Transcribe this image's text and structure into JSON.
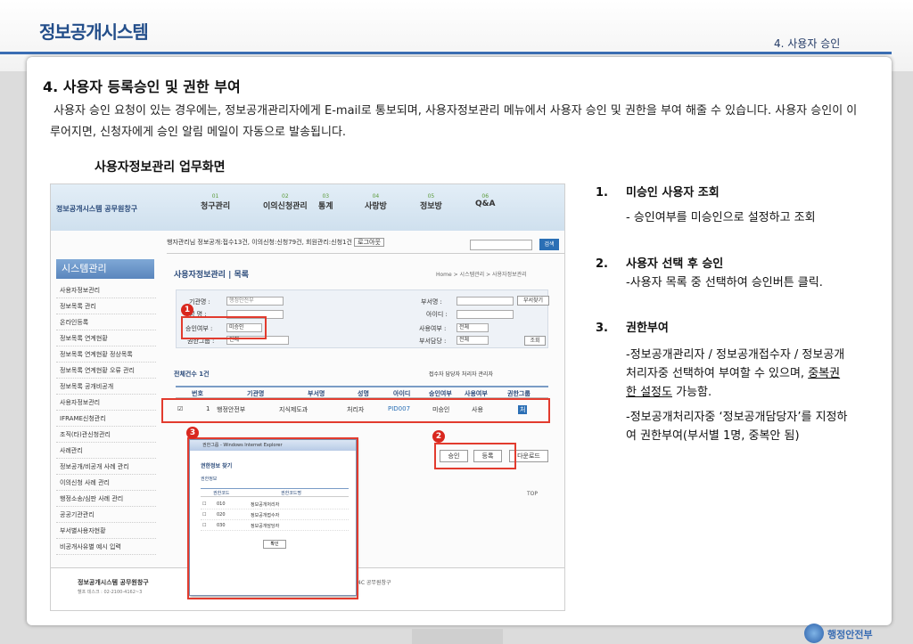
{
  "header": {
    "system_title": "정보공개시스템",
    "section_tab": "4. 사용자 승인"
  },
  "main": {
    "heading": "4. 사용자 등록승인 및 권한 부여",
    "description": "사용자 승인 요청이 있는 경우에는, 정보공개관리자에게 E-mail로 통보되며, 사용자정보관리 메뉴에서 사용자 승인 및 권한을 부여 해줄 수 있습니다. 사용자 승인이 이루어지면, 신청자에게 승인 알림 메일이 자동으로 발송됩니다.",
    "screen_title": "사용자정보관리 업무화면"
  },
  "screenshot": {
    "logo": "정보공개시스템 공무원창구",
    "nav": [
      {
        "num": "01",
        "label": "청구관리"
      },
      {
        "num": "02",
        "label": "이의신청관리"
      },
      {
        "num": "03",
        "label": "통계"
      },
      {
        "num": "04",
        "label": "사랑방"
      },
      {
        "num": "05",
        "label": "정보방"
      },
      {
        "num": "06",
        "label": "Q&A"
      }
    ],
    "user_bar": "행자관리님    정보공개:접수13건, 이의신청:신청79건, 회원관리:신청1건",
    "logout": "로그아웃",
    "search_btn": "검색",
    "sidebar_head": "시스템관리",
    "sidebar_items": [
      "사용자정보관리",
      "정보목록 관리",
      "온라인등록",
      "정보목록 연계현황",
      "정보목록 연계현황 정상목록",
      "정보목록 연계현황 오류 관리",
      "정보목록 공개비공개",
      "사용자정보관리",
      "IFRAME신청관리",
      "조직(타)관신청관리",
      "사례관리",
      "정보공개/비공개 사례 관리",
      "이의신청 사례 관리",
      "행정소송/심판 사례 관리",
      "공공기관관리",
      "부서별사용자현황",
      "비공개사유별 예시 입력"
    ],
    "content_title": "사용자정보관리 | 목록",
    "breadcrumb": "Home > 시스템관리 > 사용자정보관리",
    "form": {
      "org_label": "기관명 :",
      "org_value": "행정안전부",
      "name_label": "성 명 :",
      "approve_label": "승인여부 :",
      "approve_value": "미승인",
      "auth_label": "권한그룹 :",
      "auth_value": "전체",
      "dept_label": "부서명 :",
      "dept_btn": "부서찾기",
      "id_label": "아이디 :",
      "use_label": "사용여부 :",
      "use_value": "전체",
      "manager_label": "부서담당 :",
      "manager_value": "전체",
      "search_btn": "조회"
    },
    "total": "전체건수 1건",
    "legend": "접수자  담당자  처리자  관리자",
    "table_headers": [
      "번호",
      "기관명",
      "부서명",
      "성명",
      "아이디",
      "승인여부",
      "사용여부",
      "권한그룹"
    ],
    "table_row": [
      "1",
      "행정안전부",
      "지식제도과",
      "처리자",
      "PID007",
      "미승인",
      "사용",
      "처"
    ],
    "buttons": {
      "approve": "승인",
      "register": "등록",
      "download": "다운로드"
    },
    "top_link": "TOP",
    "footer_name": "정보공개시스템 공무원창구",
    "footer_tel": "헬프 데스크 : 02-2100-4162~3",
    "footer_mid": "4C 공무원창구",
    "popup": {
      "bar": "권한그룹 - Windows Internet Explorer",
      "title": "권한정보 찾기",
      "sub": "권한정보",
      "headers": [
        "권한코드",
        "권한코드명"
      ],
      "rows": [
        {
          "code": "010",
          "name": "정보공개처리자"
        },
        {
          "code": "020",
          "name": "정보공개접수자"
        },
        {
          "code": "030",
          "name": "정보공개담당자"
        }
      ],
      "ok": "확인"
    },
    "badges": [
      "1",
      "2",
      "3"
    ]
  },
  "steps": [
    {
      "num": "1.",
      "title": "미승인 사용자 조회",
      "desc": "- 승인여부를 미승인으로 설정하고 조회"
    },
    {
      "num": "2.",
      "title": "사용자 선택 후 승인",
      "desc": "-사용자 목록 중 선택하여 승인버튼 클릭."
    },
    {
      "num": "3.",
      "title": "권한부여",
      "desc_a": "-정보공개관리자 / 정보공개접수자 / 정보공개처리자중 선택하여 부여할 수 있으며,",
      "desc_u": "중복권한 설정도",
      "desc_b": " 가능함.",
      "desc2": "-정보공개처리자중 ‘정보공개담당자’를 지정하여 권한부여(부서별 1명, 중복안 됨)"
    }
  ],
  "footer": {
    "ministry": "행정안전부"
  }
}
